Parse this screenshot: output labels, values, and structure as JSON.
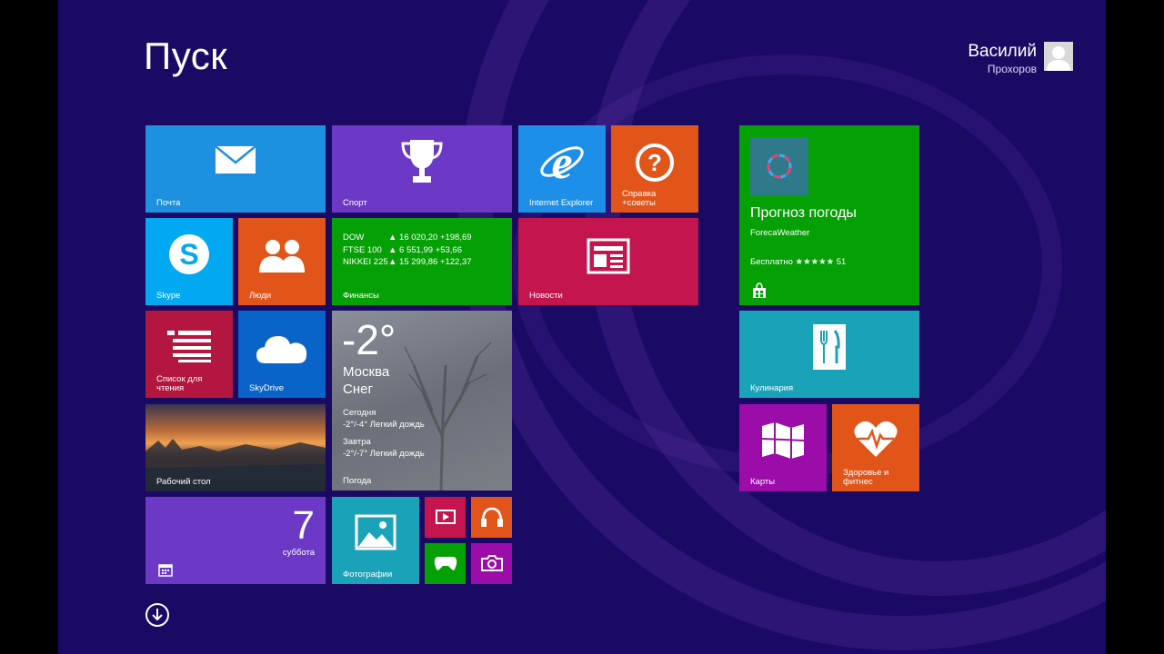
{
  "start": {
    "title": "Пуск"
  },
  "user": {
    "first_name": "Василий",
    "last_name": "Прохоров"
  },
  "colors": {
    "background": "#1b0a63",
    "blue": "#1e90e0",
    "purple": "#6b39c6",
    "green": "#05a005",
    "orange": "#e1551b",
    "red": "#c4154e",
    "crimson": "#b3163f",
    "teal": "#1aa2b8",
    "magenta": "#9c0ca8"
  },
  "tiles": {
    "mail": {
      "label": "Почта",
      "icon": "mail-icon"
    },
    "sport": {
      "label": "Спорт",
      "icon": "trophy-icon"
    },
    "ie": {
      "label": "Internet Explorer",
      "icon": "ie-icon"
    },
    "help": {
      "label": "Справка\n+советы",
      "icon": "question-icon"
    },
    "skype": {
      "label": "Skype",
      "icon": "skype-icon"
    },
    "people": {
      "label": "Люди",
      "icon": "people-icon"
    },
    "finance": {
      "label": "Финансы",
      "rows": [
        {
          "name": "DOW",
          "value": "▲ 16 020,20 +198,69"
        },
        {
          "name": "FTSE 100",
          "value": "▲ 6 551,99 +53,66"
        },
        {
          "name": "NIKKEI 225",
          "value": "▲ 15 299,86 +122,37"
        }
      ]
    },
    "news": {
      "label": "Новости",
      "icon": "newspaper-icon"
    },
    "reading": {
      "label": "Список для\nчтения",
      "icon": "reading-list-icon"
    },
    "skydrive": {
      "label": "SkyDrive",
      "icon": "cloud-icon"
    },
    "weather": {
      "label": "Погода",
      "temp": "-2°",
      "city": "Москва",
      "condition": "Снег",
      "today_title": "Сегодня",
      "today_forecast": "-2°/-4° Легкий дождь",
      "tomorrow_title": "Завтра",
      "tomorrow_forecast": "-2°/-7° Легкий дождь"
    },
    "desktop": {
      "label": "Рабочий стол"
    },
    "calendar": {
      "day_number": "7",
      "day_name": "суббота",
      "icon": "calendar-icon"
    },
    "photos": {
      "label": "Фотографии",
      "icon": "photo-icon"
    },
    "video": {
      "icon": "video-icon"
    },
    "music": {
      "icon": "headphones-icon"
    },
    "games": {
      "icon": "xbox-gamepad-icon"
    },
    "camera": {
      "icon": "camera-icon"
    },
    "weather_app": {
      "title": "Прогноз погоды",
      "publisher": "ForecaWeather",
      "price_rating": "Бесплатно ★★★★★ 51",
      "icon": "store-bag-icon"
    },
    "cooking": {
      "label": "Кулинария",
      "icon": "cutlery-icon"
    },
    "maps": {
      "label": "Карты",
      "icon": "map-icon"
    },
    "health": {
      "label": "Здоровье и\nфитнес",
      "icon": "heart-pulse-icon"
    }
  }
}
